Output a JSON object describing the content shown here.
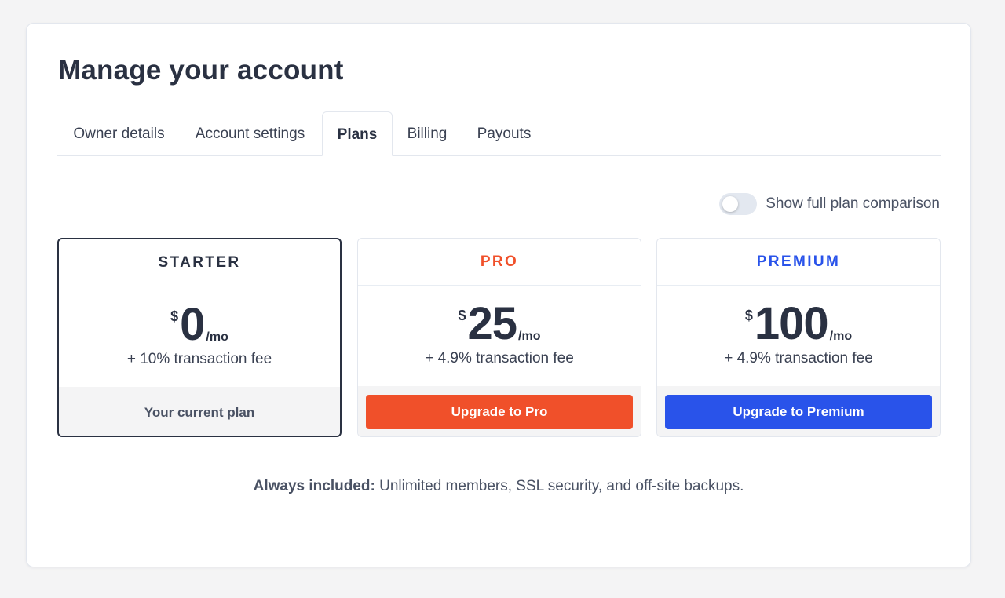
{
  "header": {
    "title": "Manage your account"
  },
  "tabs": [
    {
      "label": "Owner details",
      "active": false
    },
    {
      "label": "Account settings",
      "active": false
    },
    {
      "label": "Plans",
      "active": true
    },
    {
      "label": "Billing",
      "active": false
    },
    {
      "label": "Payouts",
      "active": false
    }
  ],
  "toggle": {
    "label": "Show full plan comparison",
    "checked": false
  },
  "plans": [
    {
      "name": "STARTER",
      "currency": "$",
      "amount": "0",
      "period": "/mo",
      "fee": "+ 10% transaction fee",
      "action": "Your current plan",
      "current": true,
      "color": "#2a3142"
    },
    {
      "name": "PRO",
      "currency": "$",
      "amount": "25",
      "period": "/mo",
      "fee": "+ 4.9% transaction fee",
      "action": "Upgrade to Pro",
      "current": false,
      "color": "#f0502a"
    },
    {
      "name": "PREMIUM",
      "currency": "$",
      "amount": "100",
      "period": "/mo",
      "fee": "+ 4.9% transaction fee",
      "action": "Upgrade to Premium",
      "current": false,
      "color": "#2953ea"
    }
  ],
  "footer": {
    "bold": "Always included:",
    "text": " Unlimited members, SSL security, and off-site backups."
  }
}
